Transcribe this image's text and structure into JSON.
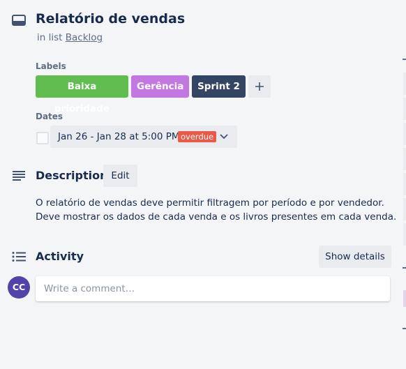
{
  "card": {
    "title": "Relatório de vendas",
    "in_list_prefix": "in list",
    "list_name": "Backlog"
  },
  "labels": {
    "heading": "Labels",
    "items": [
      {
        "text": "Baixa prioridade",
        "color": "#61bd4f"
      },
      {
        "text": "Gerência",
        "color": "#c377e0"
      },
      {
        "text": "Sprint 2",
        "color": "#344563"
      }
    ],
    "add_icon": "plus-icon"
  },
  "dates": {
    "heading": "Dates",
    "range": "Jan 26 - Jan 28 at 5:00 PM",
    "status_badge": "overdue",
    "complete": false
  },
  "description": {
    "heading": "Description",
    "edit_label": "Edit",
    "text": "O relatório de vendas deve permitir filtragem por período e por vendedor. Deve mostrar os dados de cada venda e os livros presentes em cada venda."
  },
  "activity": {
    "heading": "Activity",
    "show_details_label": "Show details",
    "avatar_initials": "CC",
    "avatar_color": "#5243aa",
    "comment_placeholder": "Write a comment…"
  },
  "colors": {
    "text": "#172b4d",
    "subtle": "#5e6c84",
    "button_bg": "#e9ebee",
    "overdue": "#eb5a46",
    "page_bg": "#f4f5f7"
  }
}
